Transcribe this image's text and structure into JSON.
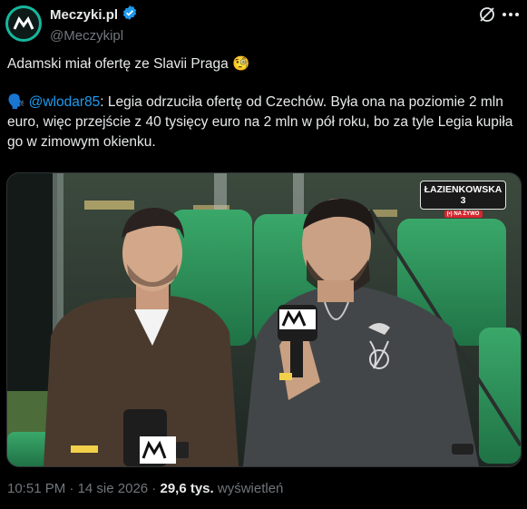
{
  "author": {
    "display_name": "Meczyki.pl",
    "handle": "@Meczykipl",
    "verified": true,
    "avatar_icon": "meczyki-logo-icon",
    "avatar_color": "#17b79c"
  },
  "actions": {
    "grok_icon": "grok-slash-icon",
    "more_icon": "more-dots-icon"
  },
  "tweet": {
    "line1": "Adamski miał ofertę ze Slavii Praga",
    "line1_emoji": "🧐",
    "speaker_emoji": "🗣️",
    "mention": "@wlodar85",
    "body": ": Legia odrzuciła ofertę od Czechów. Była ona na poziomie 2 mln euro, więc przejście z 40 tysięcy euro na 2 mln w pół roku, bo za tyle Legia kupiła go w zimowym okienku."
  },
  "media": {
    "overlay_title": "ŁAZIENKOWSKA 3",
    "overlay_live": "(•) NA ŻYWO"
  },
  "meta": {
    "time": "10:51 PM",
    "separator1": " · ",
    "date": "14 sie 2026",
    "separator2": " · ",
    "views_count": "29,6 tys.",
    "views_label": " wyświetleń"
  },
  "colors": {
    "background": "#000000",
    "text": "#e7e9ea",
    "muted": "#71767b",
    "link": "#1d9bf0",
    "verified": "#1d9bf0"
  }
}
